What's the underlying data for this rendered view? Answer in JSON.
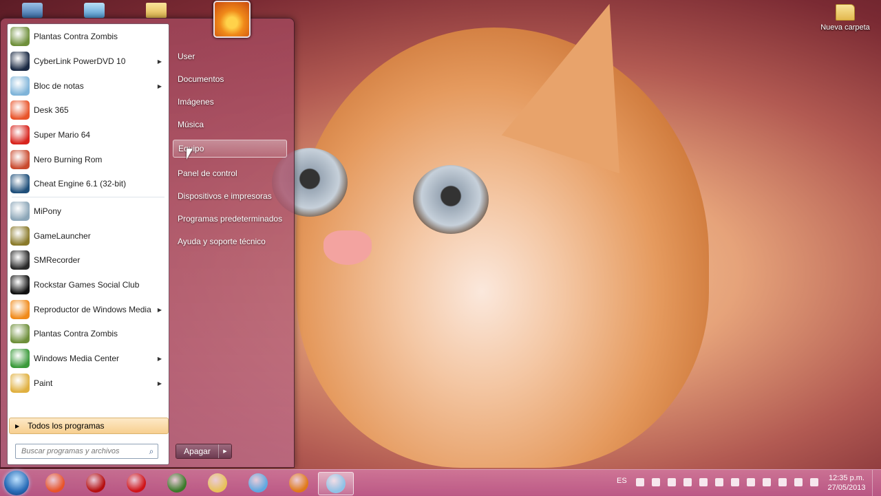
{
  "desktop": {
    "icons": [
      {
        "label": "Nueva carpeta"
      }
    ]
  },
  "start_menu": {
    "programs": [
      {
        "label": "Plantas Contra Zombis",
        "icon": "plants-vs-zombies-icon",
        "color": "#6e8f3a",
        "submenu": false
      },
      {
        "label": "CyberLink PowerDVD 10",
        "icon": "powerdvd-icon",
        "color": "#1b2a44",
        "submenu": true
      },
      {
        "label": "Bloc de notas",
        "icon": "notepad-icon",
        "color": "#7fb4d9",
        "submenu": true
      },
      {
        "label": "Desk 365",
        "icon": "desk365-icon",
        "color": "#e8542a",
        "submenu": false
      },
      {
        "label": "Super Mario 64",
        "icon": "mushroom-icon",
        "color": "#d8241d",
        "submenu": false
      },
      {
        "label": "Nero Burning Rom",
        "icon": "nero-icon",
        "color": "#c94a2e",
        "submenu": false
      },
      {
        "label": "Cheat Engine 6.1 (32-bit)",
        "icon": "cheat-engine-icon",
        "color": "#1f4f7a",
        "submenu": false
      },
      {
        "label": "MiPony",
        "icon": "mipony-icon",
        "color": "#8ca6b8",
        "submenu": false
      },
      {
        "label": "GameLauncher",
        "icon": "gamelauncher-icon",
        "color": "#8a7a2a",
        "submenu": false
      },
      {
        "label": "SMRecorder",
        "icon": "smrecorder-icon",
        "color": "#2a2a2a",
        "submenu": false
      },
      {
        "label": "Rockstar Games Social Club",
        "icon": "rockstar-icon",
        "color": "#111111",
        "submenu": false
      },
      {
        "label": "Reproductor de Windows Media",
        "icon": "windows-media-player-icon",
        "color": "#f08a1a",
        "submenu": true
      },
      {
        "label": "Plantas Contra Zombis",
        "icon": "plants-vs-zombies-icon",
        "color": "#6e8f3a",
        "submenu": false
      },
      {
        "label": "Windows Media Center",
        "icon": "media-center-icon",
        "color": "#3a9a3a",
        "submenu": true
      },
      {
        "label": "Paint",
        "icon": "paint-icon",
        "color": "#e0b040",
        "submenu": true
      }
    ],
    "all_programs": "Todos los programas",
    "search_placeholder": "Buscar programas y archivos",
    "right_items": [
      "User",
      "Documentos",
      "Imágenes",
      "Música",
      "Equipo",
      "Panel de control",
      "Dispositivos e impresoras",
      "Programas predeterminados",
      "Ayuda y soporte técnico"
    ],
    "hovered_item": "Equipo",
    "shutdown_label": "Apagar"
  },
  "taskbar": {
    "pinned": [
      {
        "name": "chrome-icon",
        "color": "#e8542a"
      },
      {
        "name": "adobe-reader-icon",
        "color": "#b50f0f"
      },
      {
        "name": "opera-icon",
        "color": "#d01419"
      },
      {
        "name": "uc-browser-icon",
        "color": "#3a7a2a"
      },
      {
        "name": "explorer-folder-icon",
        "color": "#e8c25a"
      },
      {
        "name": "home-icon",
        "color": "#5fa8e0"
      },
      {
        "name": "firefox-icon",
        "color": "#e07a1a"
      },
      {
        "name": "notepad-icon",
        "color": "#8fc2e6"
      }
    ],
    "language": "ES",
    "time": "12:35 p.m.",
    "date": "27/05/2013"
  }
}
